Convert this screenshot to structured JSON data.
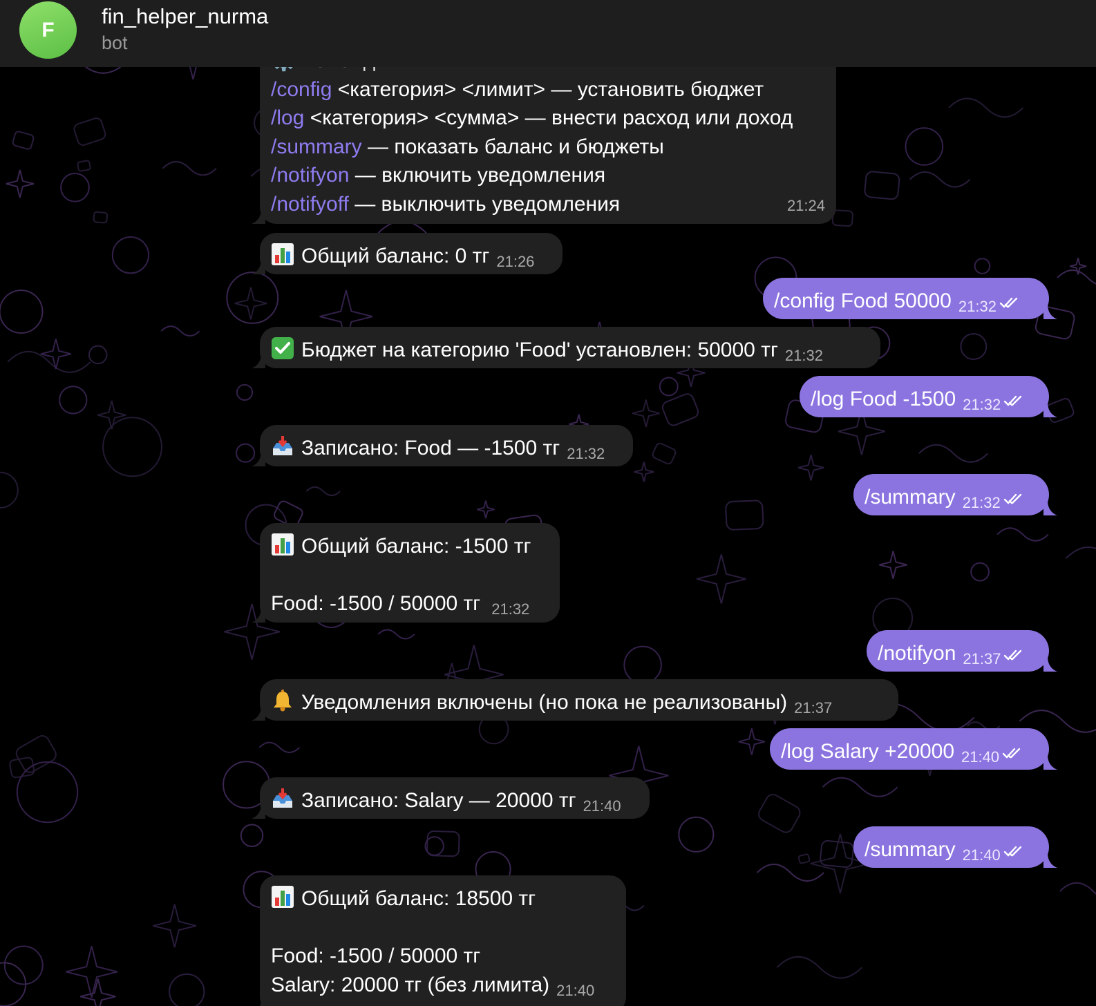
{
  "header": {
    "avatar_letter": "F",
    "title": "fin_helper_nurma",
    "subtitle": "bot"
  },
  "colors": {
    "incoming_bubble": "#212121",
    "outgoing_bubble": "#8b74e0",
    "command_link": "#8f7cf0",
    "avatar": "#6ccf52"
  },
  "messages": {
    "m1": {
      "partial_top": "⚙️ Команды:",
      "lines": [
        {
          "cmd": "/config",
          "text": " <категория> <лимит> — установить бюджет"
        },
        {
          "cmd": "/log",
          "text": " <категория> <сумма> — внести расход или доход"
        },
        {
          "cmd": "/summary",
          "text": " — показать баланс и бюджеты"
        },
        {
          "cmd": "/notifyon",
          "text": " — включить уведомления"
        },
        {
          "cmd": "/notifyoff",
          "text": " — выключить уведомления"
        }
      ],
      "time": "21:24"
    },
    "m2": {
      "icon": "bar-chart-emoji",
      "text": "Общий баланс: 0 тг",
      "time": "21:26"
    },
    "m3": {
      "text": "/config Food 50000",
      "time": "21:32"
    },
    "m4": {
      "icon": "check-mark-emoji",
      "text": "Бюджет на категорию 'Food' установлен: 50000 тг",
      "time": "21:32"
    },
    "m5": {
      "text": "/log Food -1500",
      "time": "21:32"
    },
    "m6": {
      "icon": "inbox-tray-emoji",
      "text": "Записано: Food — -1500 тг",
      "time": "21:32"
    },
    "m7": {
      "text": "/summary",
      "time": "21:32"
    },
    "m8": {
      "icon": "bar-chart-emoji",
      "line1": "Общий баланс: -1500 тг",
      "line2": "Food: -1500 / 50000 тг",
      "time": "21:32"
    },
    "m9": {
      "text": "/notifyon",
      "time": "21:37"
    },
    "m10": {
      "icon": "bell-emoji",
      "text": "Уведомления включены (но пока не реализованы)",
      "time": "21:37"
    },
    "m11": {
      "text": "/log Salary +20000",
      "time": "21:40"
    },
    "m12": {
      "icon": "inbox-tray-emoji",
      "text": "Записано: Salary — 20000 тг",
      "time": "21:40"
    },
    "m13": {
      "text": "/summary",
      "time": "21:40"
    },
    "m14": {
      "icon": "bar-chart-emoji",
      "line1": "Общий баланс: 18500 тг",
      "line2": "Food: -1500 / 50000 тг",
      "line3": "Salary: 20000 тг (без лимита)",
      "time": "21:40"
    }
  }
}
